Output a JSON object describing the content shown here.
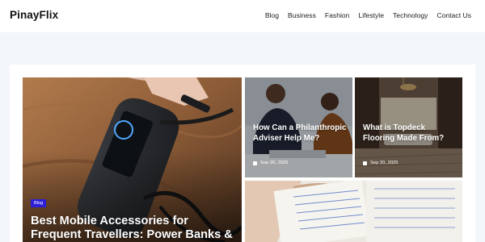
{
  "site": {
    "name": "PinayFlix"
  },
  "nav": {
    "items": [
      "Blog",
      "Business",
      "Fashion",
      "Lifestyle",
      "Technology",
      "Contact Us"
    ]
  },
  "featured": {
    "category": "Blog",
    "title": "Best Mobile Accessories for Frequent Travellers: Power Banks &"
  },
  "posts": [
    {
      "title": "How Can a Philanthropic Adviser Help Me?",
      "date": "Sep 20, 2025"
    },
    {
      "title": "What is Topdeck Flooring Made From?",
      "date": "Sep 20, 2025"
    }
  ],
  "icons": {
    "date": "calendar-icon"
  },
  "colors": {
    "accent": "#2d1fd9",
    "page_bg": "#f3f6fa"
  }
}
